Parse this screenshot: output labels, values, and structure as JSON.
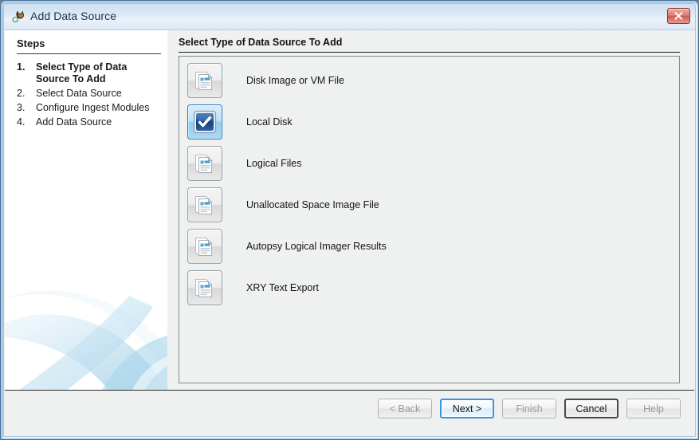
{
  "window": {
    "title": "Add Data Source",
    "app_icon": "autopsy-dog-icon",
    "close_label": "x"
  },
  "steps": {
    "heading": "Steps",
    "items": [
      {
        "num": "1.",
        "label": "Select Type of Data Source To Add",
        "current": true
      },
      {
        "num": "2.",
        "label": "Select Data Source",
        "current": false
      },
      {
        "num": "3.",
        "label": "Configure Ingest Modules",
        "current": false
      },
      {
        "num": "4.",
        "label": "Add Data Source",
        "current": false
      }
    ]
  },
  "main": {
    "title": "Select Type of Data Source To Add",
    "sources": [
      {
        "label": "Disk Image or VM File",
        "icon": "documents-stack-icon",
        "selected": false
      },
      {
        "label": "Local Disk",
        "icon": "blue-check-disk-icon",
        "selected": true
      },
      {
        "label": "Logical Files",
        "icon": "documents-stack-icon",
        "selected": false
      },
      {
        "label": "Unallocated Space Image File",
        "icon": "documents-stack-icon",
        "selected": false
      },
      {
        "label": "Autopsy Logical Imager Results",
        "icon": "documents-stack-icon",
        "selected": false
      },
      {
        "label": "XRY Text Export",
        "icon": "documents-stack-icon",
        "selected": false
      }
    ]
  },
  "footer": {
    "buttons": [
      {
        "label": "< Back",
        "state": "disabled"
      },
      {
        "label": "Next >",
        "state": "focused"
      },
      {
        "label": "Finish",
        "state": "disabled"
      },
      {
        "label": "Cancel",
        "state": "default"
      },
      {
        "label": "Help",
        "state": "disabled"
      }
    ]
  },
  "colors": {
    "accent": "#3c93d6",
    "titlebar": "#dbe9f6",
    "panel": "#eff0f0",
    "close_red": "#cf5b50"
  }
}
